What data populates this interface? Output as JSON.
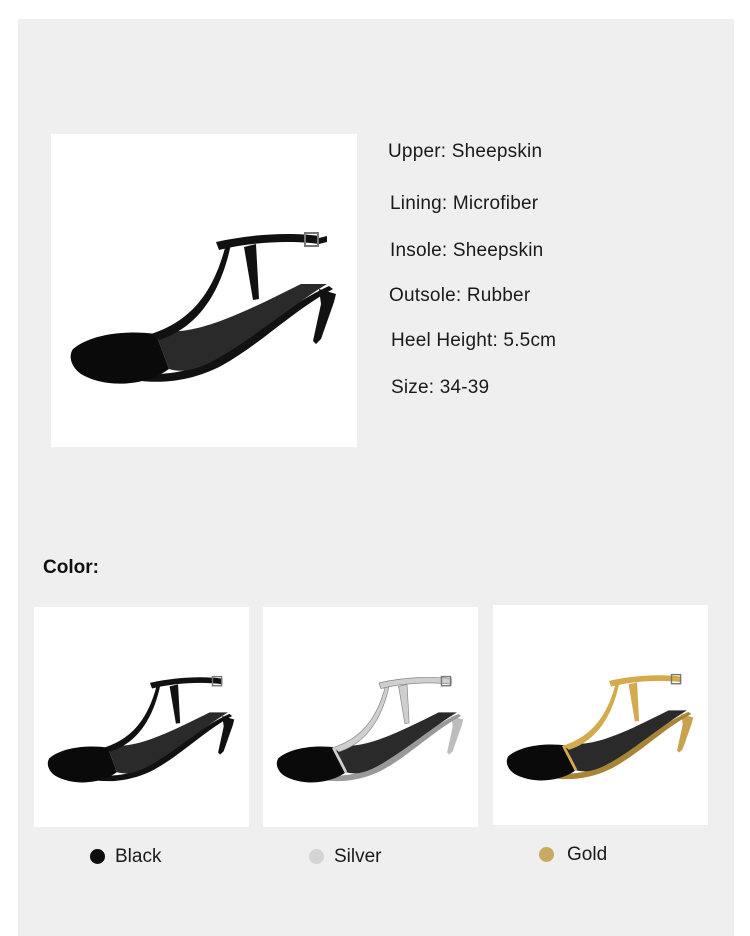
{
  "specs": [
    {
      "label": "Upper",
      "value": "Sheepskin"
    },
    {
      "label": "Lining",
      "value": "Microfiber"
    },
    {
      "label": "Insole",
      "value": "Sheepskin"
    },
    {
      "label": "Outsole",
      "value": "Rubber"
    },
    {
      "label": "Heel Height",
      "value": "5.5cm"
    },
    {
      "label": "Size",
      "value": "34-39"
    }
  ],
  "spec_text": [
    "Upper: Sheepskin",
    "Lining: Microfiber",
    "Insole: Sheepskin",
    "Outsole: Rubber",
    "Heel Height: 5.5cm",
    "Size: 34-39"
  ],
  "color_heading": "Color:",
  "colors": [
    {
      "name": "Black",
      "swatch": "#0d0d0d",
      "strap": "#111111"
    },
    {
      "name": "Silver",
      "swatch": "#d4d4d4",
      "strap": "#c9c9c9"
    },
    {
      "name": "Gold",
      "swatch": "#c9a964",
      "strap": "#c9a24e"
    }
  ],
  "icons": {
    "product": "heel-sandal-icon"
  }
}
